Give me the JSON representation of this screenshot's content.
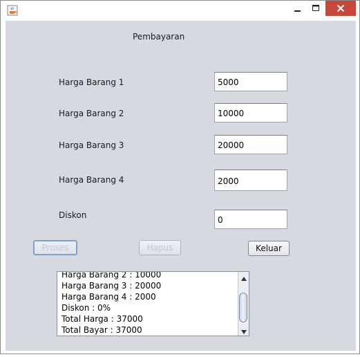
{
  "window": {
    "title": "",
    "icons": {
      "app": "java-cup-icon",
      "minimize": "minimize-icon",
      "maximize": "maximize-icon",
      "close": "close-icon"
    }
  },
  "form": {
    "heading": "Pembayaran",
    "fields": [
      {
        "label": "Harga Barang 1",
        "value": "5000"
      },
      {
        "label": "Harga Barang 2",
        "value": "10000"
      },
      {
        "label": "Harga Barang 3",
        "value": "20000"
      },
      {
        "label": "Harga Barang 4",
        "value": "2000"
      },
      {
        "label": "Diskon",
        "value": "0"
      }
    ]
  },
  "buttons": {
    "proses": "Proses",
    "hapus": "Hapus",
    "keluar": "Keluar"
  },
  "output": {
    "lines": [
      "Harga Barang 2 : 10000",
      "Harga Barang 3 : 20000",
      "Harga Barang 4 : 2000",
      "Diskon : 0%",
      "Total Harga : 37000",
      "Total Bayar : 37000"
    ]
  },
  "colors": {
    "panel": "#d6d9df",
    "close": "#c7473a"
  }
}
